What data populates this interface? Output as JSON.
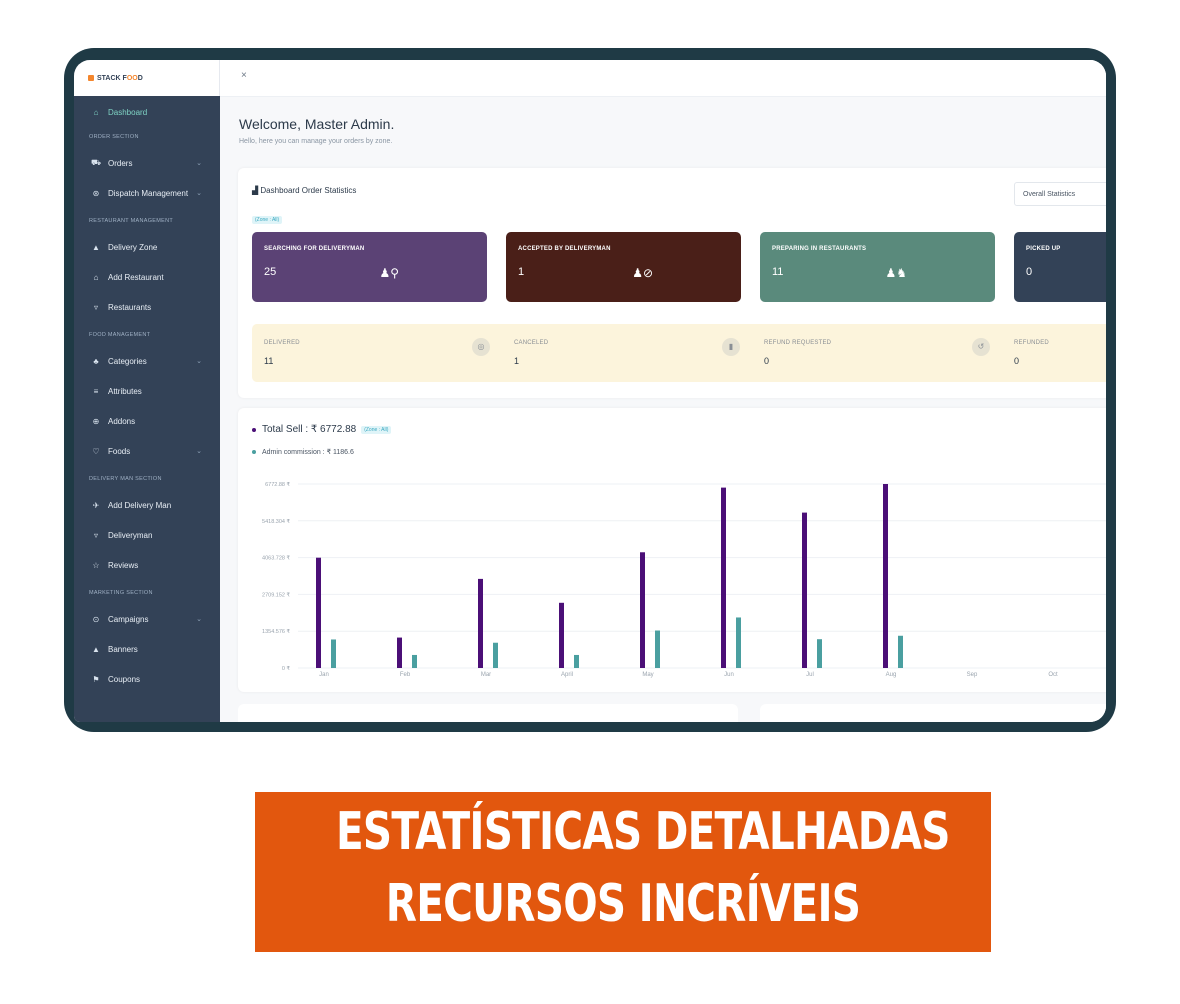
{
  "brand": {
    "name_part1": "STACK F",
    "name_accent": "OO",
    "name_part2": "D"
  },
  "sidebar": {
    "dashboard": "Dashboard",
    "sections": {
      "order": "ORDER SECTION",
      "restaurant": "RESTAURANT MANAGEMENT",
      "food": "FOOD MANAGEMENT",
      "delivery": "DELIVERY MAN SECTION",
      "marketing": "MARKETING SECTION"
    },
    "items": {
      "orders": "Orders",
      "dispatch": "Dispatch Management",
      "delivery_zone": "Delivery Zone",
      "add_restaurant": "Add Restaurant",
      "restaurants": "Restaurants",
      "categories": "Categories",
      "attributes": "Attributes",
      "addons": "Addons",
      "foods": "Foods",
      "add_delivery_man": "Add Delivery Man",
      "deliveryman": "Deliveryman",
      "reviews": "Reviews",
      "campaigns": "Campaigns",
      "banners": "Banners",
      "coupons": "Coupons"
    }
  },
  "header": {
    "close_symbol": "×",
    "welcome": "Welcome, Master Admin.",
    "subtitle": "Hello, here you can manage your orders by zone."
  },
  "stats": {
    "title": "Dashboard Order Statistics",
    "zone_badge": "(Zone : All)",
    "select_value": "Overall Statistics",
    "cards": [
      {
        "label": "SEARCHING FOR DELIVERYMAN",
        "value": "25",
        "color": "#5b4275"
      },
      {
        "label": "ACCEPTED BY DELIVERYMAN",
        "value": "1",
        "color": "#4a1f18"
      },
      {
        "label": "PREPARING IN RESTAURANTS",
        "value": "11",
        "color": "#5a8a7c"
      },
      {
        "label": "PICKED UP",
        "value": "0",
        "color": "#334257"
      }
    ],
    "strip": [
      {
        "label": "DELIVERED",
        "value": "11"
      },
      {
        "label": "CANCELED",
        "value": "1"
      },
      {
        "label": "REFUND REQUESTED",
        "value": "0"
      },
      {
        "label": "REFUNDED",
        "value": "0"
      }
    ]
  },
  "sales": {
    "total_label": "Total Sell : ₹ 6772.88",
    "zone_badge": "(Zone : All)",
    "commission_label": "Admin commission : ₹ 1186.6",
    "colors": {
      "sell": "#4b0f77",
      "commission": "#4a9fa0"
    }
  },
  "chart_data": {
    "type": "bar",
    "categories": [
      "Jan",
      "Feb",
      "Mar",
      "April",
      "May",
      "Jun",
      "Jul",
      "Aug",
      "Sep",
      "Oct"
    ],
    "series": [
      {
        "name": "Total Sell",
        "values": [
          4060,
          1120,
          3280,
          2400,
          4260,
          6640,
          5720,
          6772.88,
          0,
          0
        ]
      },
      {
        "name": "Admin commission",
        "values": [
          1050,
          480,
          930,
          480,
          1380,
          1860,
          1060,
          1186.6,
          0,
          0
        ]
      }
    ],
    "yticks": [
      "0 ₹",
      "1354.576 ₹",
      "2709.152 ₹",
      "4063.728 ₹",
      "5418.304 ₹",
      "6772.88 ₹"
    ],
    "ylim": [
      0,
      6772.88
    ]
  },
  "banner": {
    "line1": "ESTATÍSTICAS DETALHADAS",
    "line2": "RECURSOS INCRÍVEIS"
  }
}
